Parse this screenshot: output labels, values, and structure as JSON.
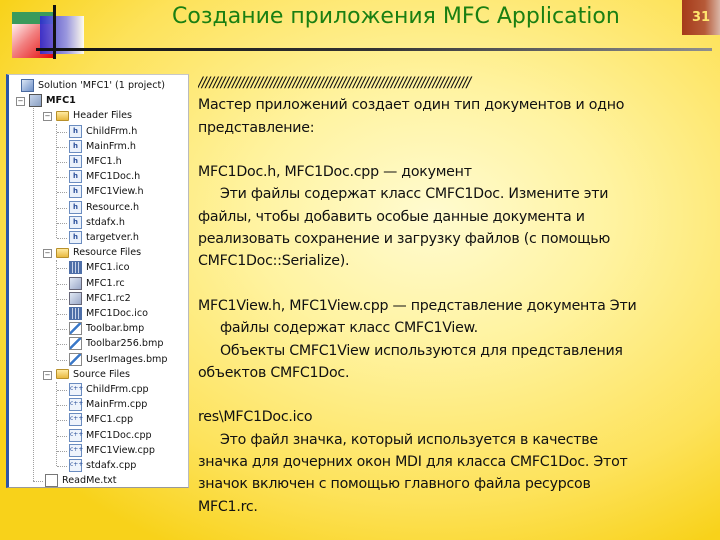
{
  "slide": {
    "title": "Создание приложения MFC Application",
    "page_number": "31",
    "colors": {
      "title": "#1a7f12",
      "page_badge_bg": "#a53a1a",
      "page_badge_text": "#ffe66e",
      "background": "#fde25a"
    }
  },
  "solution_explorer": {
    "items": [
      {
        "label": "Solution 'MFC1' (1 project)",
        "icon": "solution-icon",
        "level": 0
      },
      {
        "label": "MFC1",
        "icon": "project-icon",
        "level": 0,
        "bold": true,
        "expander": "minus"
      },
      {
        "label": "Header Files",
        "icon": "folder-icon",
        "level": 1,
        "expander": "minus"
      },
      {
        "label": "ChildFrm.h",
        "icon": "header-file-icon",
        "level": 2
      },
      {
        "label": "MainFrm.h",
        "icon": "header-file-icon",
        "level": 2
      },
      {
        "label": "MFC1.h",
        "icon": "header-file-icon",
        "level": 2
      },
      {
        "label": "MFC1Doc.h",
        "icon": "header-file-icon",
        "level": 2
      },
      {
        "label": "MFC1View.h",
        "icon": "header-file-icon",
        "level": 2
      },
      {
        "label": "Resource.h",
        "icon": "header-file-icon",
        "level": 2
      },
      {
        "label": "stdafx.h",
        "icon": "header-file-icon",
        "level": 2
      },
      {
        "label": "targetver.h",
        "icon": "header-file-icon",
        "level": 2
      },
      {
        "label": "Resource Files",
        "icon": "folder-icon",
        "level": 1,
        "expander": "minus"
      },
      {
        "label": "MFC1.ico",
        "icon": "ico-file-icon",
        "level": 2
      },
      {
        "label": "MFC1.rc",
        "icon": "rc-file-icon",
        "level": 2
      },
      {
        "label": "MFC1.rc2",
        "icon": "rc-file-icon",
        "level": 2
      },
      {
        "label": "MFC1Doc.ico",
        "icon": "ico-file-icon",
        "level": 2
      },
      {
        "label": "Toolbar.bmp",
        "icon": "bitmap-file-icon",
        "level": 2
      },
      {
        "label": "Toolbar256.bmp",
        "icon": "bitmap-file-icon",
        "level": 2
      },
      {
        "label": "UserImages.bmp",
        "icon": "bitmap-file-icon",
        "level": 2
      },
      {
        "label": "Source Files",
        "icon": "folder-icon",
        "level": 1,
        "expander": "minus"
      },
      {
        "label": "ChildFrm.cpp",
        "icon": "cpp-file-icon",
        "level": 2
      },
      {
        "label": "MainFrm.cpp",
        "icon": "cpp-file-icon",
        "level": 2
      },
      {
        "label": "MFC1.cpp",
        "icon": "cpp-file-icon",
        "level": 2
      },
      {
        "label": "MFC1Doc.cpp",
        "icon": "cpp-file-icon",
        "level": 2
      },
      {
        "label": "MFC1View.cpp",
        "icon": "cpp-file-icon",
        "level": 2
      },
      {
        "label": "stdafx.cpp",
        "icon": "cpp-file-icon",
        "level": 2
      },
      {
        "label": "ReadMe.txt",
        "icon": "text-file-icon",
        "level": 1
      }
    ]
  },
  "body": {
    "separator": "////////////////////////////////////////////////////////////////////////",
    "lines": [
      {
        "text": "Мастер приложений создает один тип документов и одно",
        "indent": false
      },
      {
        "text": "представление:",
        "indent": false
      },
      {
        "text": "",
        "indent": false
      },
      {
        "text": "MFC1Doc.h, MFC1Doc.cpp —  документ",
        "indent": false
      },
      {
        "text": "Эти файлы содержат класс CMFC1Doc. Измените эти",
        "indent": true
      },
      {
        "text": "файлы, чтобы добавить особые данные документа и",
        "indent": false
      },
      {
        "text": "реализовать сохранение и загрузку файлов (с помощью",
        "indent": false
      },
      {
        "text": "CMFC1Doc::Serialize).",
        "indent": false
      },
      {
        "text": "",
        "indent": false
      },
      {
        "text": "MFC1View.h, MFC1View.cpp — представление документа Эти",
        "indent": false
      },
      {
        "text": "файлы содержат класс CMFC1View.",
        "indent": true
      },
      {
        "text": "Объекты CMFC1View используются для представления",
        "indent": true
      },
      {
        "text": "объектов CMFC1Doc.",
        "indent": false
      },
      {
        "text": "",
        "indent": false
      },
      {
        "text": "res\\MFC1Doc.ico",
        "indent": false
      },
      {
        "text": "Это файл значка, который используется в качестве",
        "indent": true
      },
      {
        "text": "значка для дочерних окон MDI для класса CMFC1Doc.  Этот",
        "indent": false
      },
      {
        "text": "значок включен с помощью главного файла ресурсов",
        "indent": false
      },
      {
        "text": "MFC1.rc.",
        "indent": false
      }
    ]
  }
}
